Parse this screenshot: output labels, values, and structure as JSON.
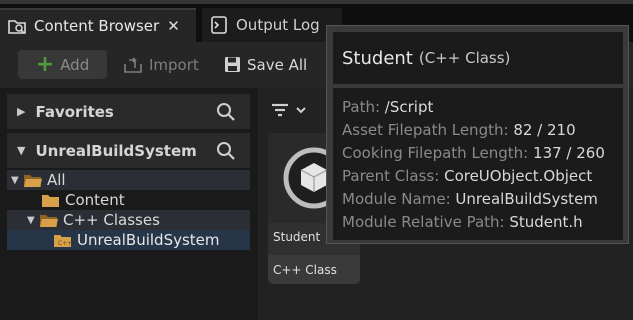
{
  "tabs": [
    {
      "label": "Content Browser",
      "close": "✕",
      "icon": "content-browser-icon"
    },
    {
      "label": "Output Log",
      "icon": "output-log-icon"
    }
  ],
  "toolbar": {
    "add_label": "Add",
    "import_label": "Import",
    "save_all_label": "Save All"
  },
  "sidebar": {
    "favorites_label": "Favorites",
    "project_label": "UnrealBuildSystem",
    "tree": [
      {
        "label": "All"
      },
      {
        "label": "Content"
      },
      {
        "label": "C++ Classes"
      },
      {
        "label": "UnrealBuildSystem"
      }
    ]
  },
  "asset": {
    "name": "Student",
    "type": "C++ Class"
  },
  "tooltip": {
    "title": "Student",
    "subtitle": "(C++ Class)",
    "rows": [
      {
        "key": "Path:",
        "value": "/Script"
      },
      {
        "key": "Asset Filepath Length:",
        "value": "82 / 210"
      },
      {
        "key": "Cooking Filepath Length:",
        "value": "137 / 260"
      },
      {
        "key": "Parent Class:",
        "value": "CoreUObject.Object"
      },
      {
        "key": "Module Name:",
        "value": "UnrealBuildSystem"
      },
      {
        "key": "Module Relative Path:",
        "value": "Student.h"
      }
    ]
  },
  "colors": {
    "accent_green": "#4f9b3f",
    "selection": "#263548",
    "folder": "#c9913f"
  }
}
